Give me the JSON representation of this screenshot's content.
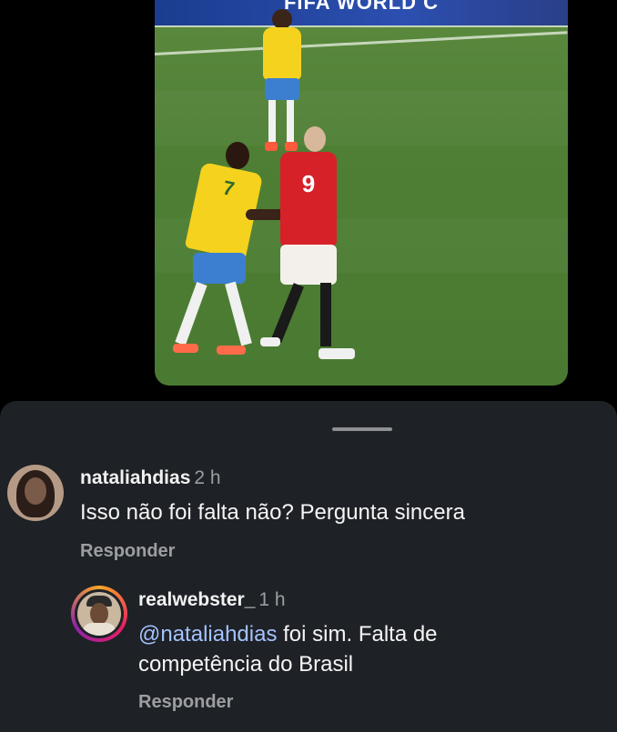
{
  "video": {
    "banner_text": "FIFA WORLD C",
    "player_front_number": "7",
    "player_opponent_number": "9"
  },
  "comments": [
    {
      "username": "nataliahdias",
      "time": "2 h",
      "text": "Isso não foi falta não? Pergunta sincera",
      "reply_label": "Responder"
    },
    {
      "username": "realwebster_",
      "time": "1 h",
      "mention": "@nataliahdias",
      "text_line1": " foi sim. Falta de",
      "text_line2": "competência do Brasil",
      "reply_label": "Responder"
    }
  ],
  "colors": {
    "sheet_bg": "#1e2125",
    "mention": "#a4c2ff",
    "muted": "#9c9ea2"
  }
}
